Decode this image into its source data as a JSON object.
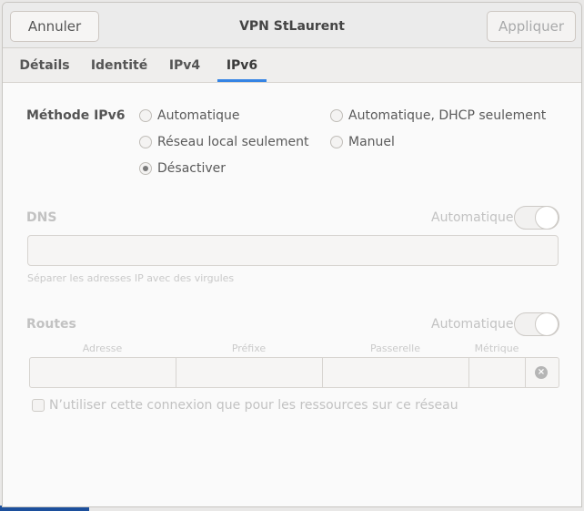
{
  "window": {
    "title": "VPN StLaurent"
  },
  "header": {
    "cancel_label": "Annuler",
    "apply_label": "Appliquer"
  },
  "tabs": [
    {
      "label": "Détails"
    },
    {
      "label": "Identité"
    },
    {
      "label": "IPv4"
    },
    {
      "label": "IPv6",
      "active": true
    }
  ],
  "ipv6": {
    "method_label": "Méthode IPv6",
    "options": {
      "auto": "Automatique",
      "auto_dhcp": "Automatique, DHCP seulement",
      "local": "Réseau local seulement",
      "manual": "Manuel",
      "disable": "Désactiver"
    },
    "selected": "Désactiver"
  },
  "dns": {
    "title": "DNS",
    "auto_label": "Automatique",
    "auto_on": true,
    "input_value": "",
    "hint": "Séparer les adresses IP avec des virgules"
  },
  "routes": {
    "title": "Routes",
    "auto_label": "Automatique",
    "auto_on": true,
    "columns": {
      "address": "Adresse",
      "prefix": "Préfixe",
      "gateway": "Passerelle",
      "metric": "Métrique"
    },
    "clear_icon": "clear-icon"
  },
  "only_resources": {
    "label": "N’utiliser cette connexion que pour les ressources sur ce réseau",
    "checked": false
  }
}
